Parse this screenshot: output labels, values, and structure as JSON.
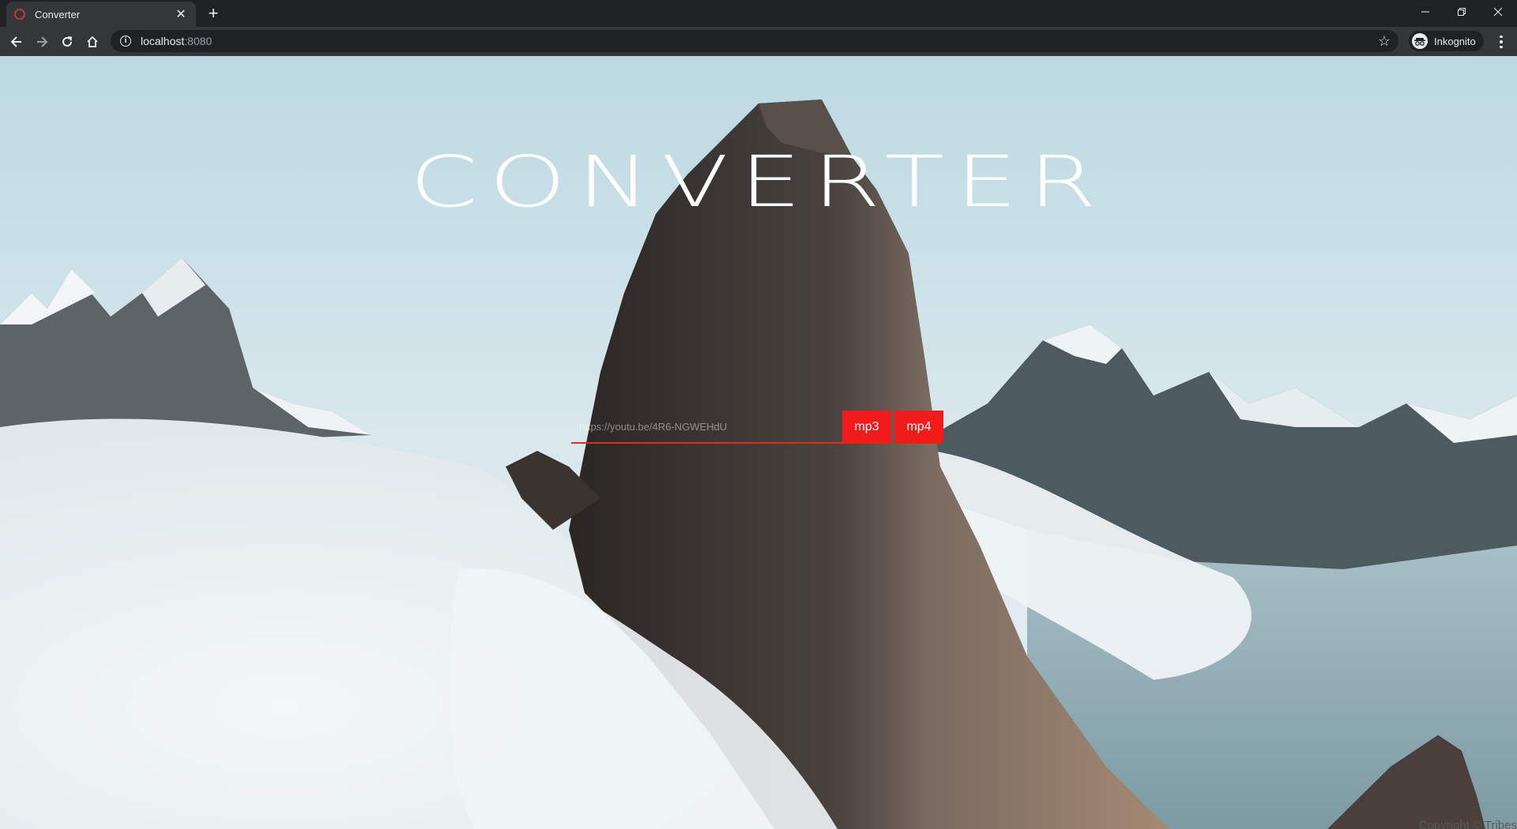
{
  "browser": {
    "tab_title": "Converter",
    "tab_close": "✕",
    "new_tab": "+",
    "url_host": "localhost",
    "url_port": ":8080",
    "profile_label": "Inkognito"
  },
  "page": {
    "heading": "CONVERTER",
    "input": {
      "placeholder": "https://youtu.be/4R6-NGWEHdU",
      "value": ""
    },
    "buttons": {
      "mp3": "mp3",
      "mp4": "mp4"
    },
    "footer": "Copyright © Tribes"
  },
  "colors": {
    "accent_red": "#f21b1b",
    "underline_red": "#e8272b",
    "chrome_dark": "#202124",
    "chrome_toolbar": "#35363a"
  }
}
